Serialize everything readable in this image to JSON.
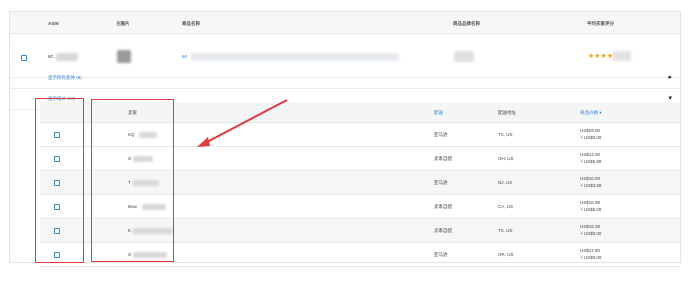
{
  "header": {
    "asin": "ASIN",
    "image": "主图片",
    "product_name": "商品名称",
    "brand": "商品品牌名称",
    "rating": "平均买家评分"
  },
  "product": {
    "asin_prefix": "9C",
    "name_prefix": "60",
    "stars": "★★★★"
  },
  "links": {
    "variants": "显示所有变体 (8)",
    "offers": "显示报价 (10)"
  },
  "offers_header": {
    "seller": "卖家",
    "fulfillment": "配送",
    "location": "配送地址",
    "price": "商品价格 ▾"
  },
  "offers": [
    {
      "seller": "KQ",
      "fulfillment": "亚马逊",
      "location": "TX, US",
      "price": "US$29.00",
      "shipping": "+ US$0.00"
    },
    {
      "seller": "S",
      "fulfillment": "卖家自配",
      "location": "OH, US",
      "price": "US$14.00",
      "shipping": "+ US$5.98"
    },
    {
      "seller": "T",
      "fulfillment": "亚马逊",
      "location": "NJ, US",
      "price": "US$16.00",
      "shipping": "+ US$3.99"
    },
    {
      "seller": "Bow",
      "fulfillment": "卖家自配",
      "location": "CA, US",
      "price": "US$16.98",
      "shipping": "+ US$5.00"
    },
    {
      "seller": "K",
      "fulfillment": "卖家自配",
      "location": "TX, US",
      "price": "US$19.38",
      "shipping": "+ US$0.00"
    },
    {
      "seller": "S",
      "fulfillment": "亚马逊",
      "location": "OR, US",
      "price": "US$17.90",
      "shipping": "+ US$0.00"
    }
  ],
  "colors": {
    "link": "#2f7fd0",
    "highlight": "#e23b3b",
    "stars": "#f0a020"
  }
}
